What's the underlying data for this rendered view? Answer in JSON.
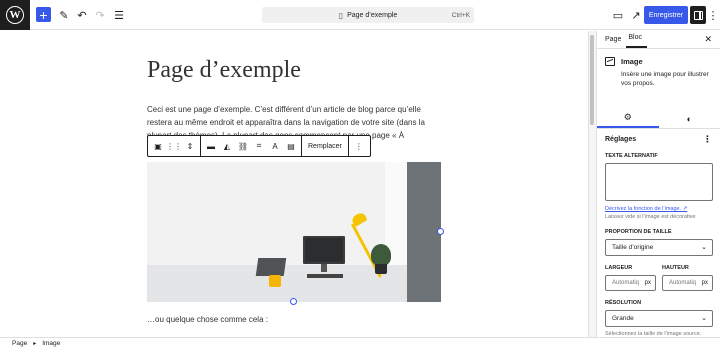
{
  "topbar": {
    "logo": "W",
    "command_bar": "Page d’exemple",
    "command_shortcut": "Ctrl+K",
    "save_label": "Enregistrer"
  },
  "canvas": {
    "title": "Page d’exemple",
    "paragraph": "Ceci est une page d’exemple. C’est différent d’un article de blog parce qu’elle restera au même endroit et apparaîtra dans la navigation de votre site (dans la plupart des thèmes). La plupart des gens commencent par une page « À",
    "toolbar_replace": "Remplacer",
    "caption": "…ou quelque chose comme cela :"
  },
  "sidebar": {
    "tab_page": "Page",
    "tab_block": "Bloc",
    "block_name": "Image",
    "block_description": "Insère une image pour illustrer vos propos.",
    "panel_title": "Réglages",
    "alt_label": "TEXTE ALTERNATIF",
    "alt_value": "",
    "alt_help_link": "Décrivez la fonction de l’image.",
    "alt_help_text": "Laissez vide si l’image est décorative",
    "aspect_label": "PROPORTION DE TAILLE",
    "aspect_value": "Taille d’origine",
    "width_label": "LARGEUR",
    "height_label": "HAUTEUR",
    "width_placeholder": "Automatiq",
    "height_placeholder": "Automatiq",
    "unit": "px",
    "resolution_label": "RÉSOLUTION",
    "resolution_value": "Grande",
    "resolution_help": "Sélectionnez la taille de l’image source."
  },
  "footer": {
    "crumb_1": "Page",
    "crumb_2": "Image"
  },
  "colors": {
    "accent": "#3858e9",
    "dark": "#1e1e1e",
    "lamp": "#f5c400"
  }
}
